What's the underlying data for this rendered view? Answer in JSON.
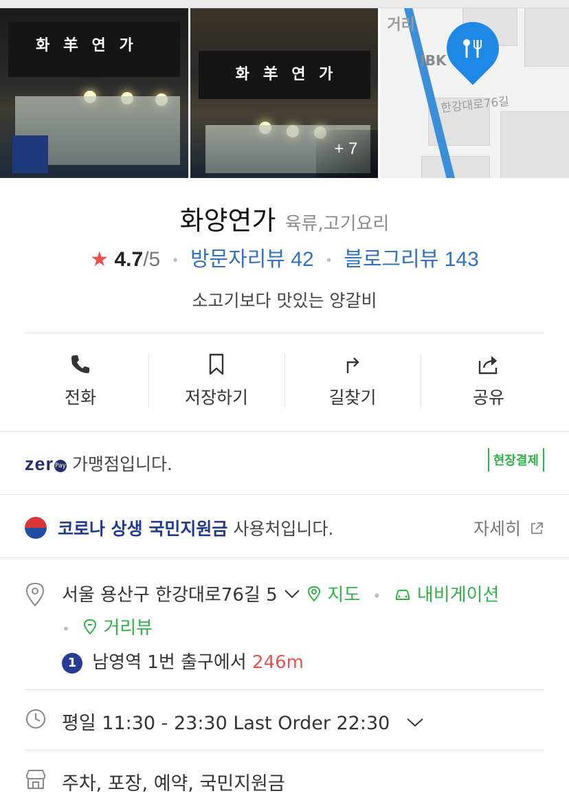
{
  "photos": {
    "sign_text": "화 羊 연 가",
    "more_count": "+ 7",
    "map_labels": [
      "거리",
      "IBK",
      "한강대로76길"
    ]
  },
  "place": {
    "name": "화양연가",
    "category": "육류,고기요리",
    "rating": "4.7",
    "rating_max": "/5",
    "visitor_reviews": "방문자리뷰 42",
    "blog_reviews": "블로그리뷰 143",
    "tagline": "소고기보다 맛있는 양갈비"
  },
  "actions": [
    {
      "label": "전화",
      "icon": "phone-icon"
    },
    {
      "label": "저장하기",
      "icon": "bookmark-icon"
    },
    {
      "label": "길찾기",
      "icon": "directions-icon"
    },
    {
      "label": "공유",
      "icon": "share-icon"
    }
  ],
  "zeropay": {
    "logo": "zer",
    "badge": "Pay",
    "text": "가맹점입니다.",
    "onsite": "현장결제"
  },
  "corona": {
    "strong": "코로나 상생 국민지원금",
    "text": "사용처입니다.",
    "details": "자세히"
  },
  "address": {
    "text": "서울 용산구 한강대로76길 5",
    "map_link": "지도",
    "navi_link": "내비게이션",
    "street_view": "거리뷰",
    "metro_line": "1",
    "metro_station": "남영역",
    "metro_exit": "1번 출구에서",
    "metro_distance": "246m"
  },
  "hours": {
    "text": "평일 11:30 - 23:30 Last Order 22:30"
  },
  "amenities": {
    "text": "주차, 포장, 예약, 국민지원금"
  },
  "colors": {
    "link_blue": "#2e72c6",
    "green": "#2fb344",
    "star_red": "#f04e4e",
    "distance_red": "#e55353",
    "zeropay_navy": "#23306b"
  }
}
